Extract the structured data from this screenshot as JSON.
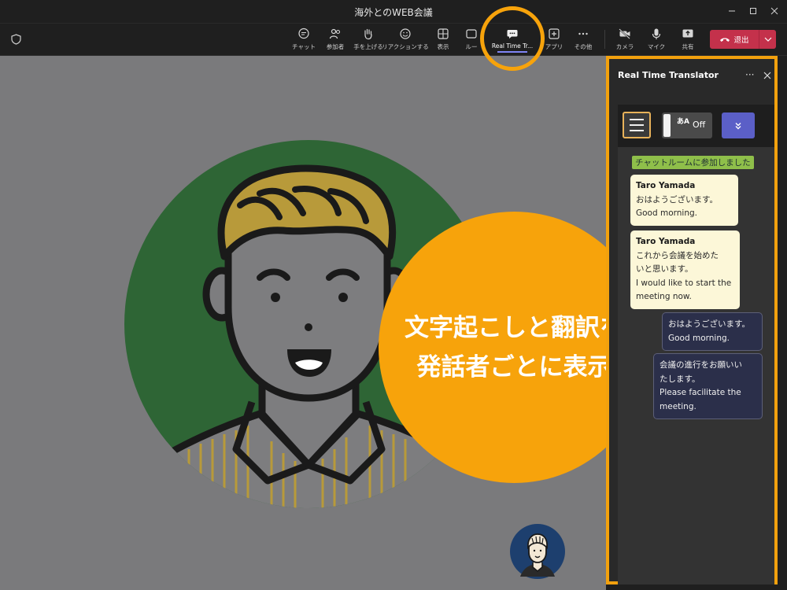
{
  "window": {
    "title": "海外とのWEB会議"
  },
  "toolbar": {
    "items": [
      {
        "label": "チャット",
        "icon": "chat-icon"
      },
      {
        "label": "参加者",
        "icon": "people-icon"
      },
      {
        "label": "手を上げる",
        "icon": "raise-hand-icon"
      },
      {
        "label": "リアクションする",
        "icon": "smile-icon"
      },
      {
        "label": "表示",
        "icon": "grid-view-icon"
      },
      {
        "label": "ルー",
        "icon": "rooms-icon"
      },
      {
        "label": "Real Time Tr...",
        "icon": "translator-app-icon"
      },
      {
        "label": "アプリ",
        "icon": "add-app-icon"
      },
      {
        "label": "その他",
        "icon": "more-icon"
      },
      {
        "label": "カメラ",
        "icon": "camera-off-icon"
      },
      {
        "label": "マイク",
        "icon": "mic-icon"
      },
      {
        "label": "共有",
        "icon": "share-icon"
      }
    ],
    "leave_label": "退出"
  },
  "panel": {
    "title": "Real Time Translator",
    "toggle_label": "Off",
    "toggle_icon_text": "あA",
    "system_message": "チャットルームに参加しました",
    "messages": [
      {
        "sender": "Taro Yamada",
        "lines": [
          "おはようございます。",
          "Good morning."
        ]
      },
      {
        "sender": "Taro Yamada",
        "lines": [
          "これから会議を始めた",
          "いと思います。",
          "I would like to start the",
          "meeting now."
        ]
      },
      {
        "sender": "",
        "lines": [
          "おはようございます。",
          "Good morning."
        ]
      },
      {
        "sender": "",
        "lines": [
          "会議の進行をお願いい",
          "たします。",
          "Please facilitate the",
          "meeting."
        ]
      }
    ]
  },
  "annotation": {
    "callout_line1": "文字起こしと翻訳を",
    "callout_line2": "発話者ごとに表示",
    "highlight_color": "#f7a30b"
  },
  "colors": {
    "leave_button": "#c4314b",
    "accent": "#5b5fc7",
    "avatar_background": "#2e6535"
  }
}
